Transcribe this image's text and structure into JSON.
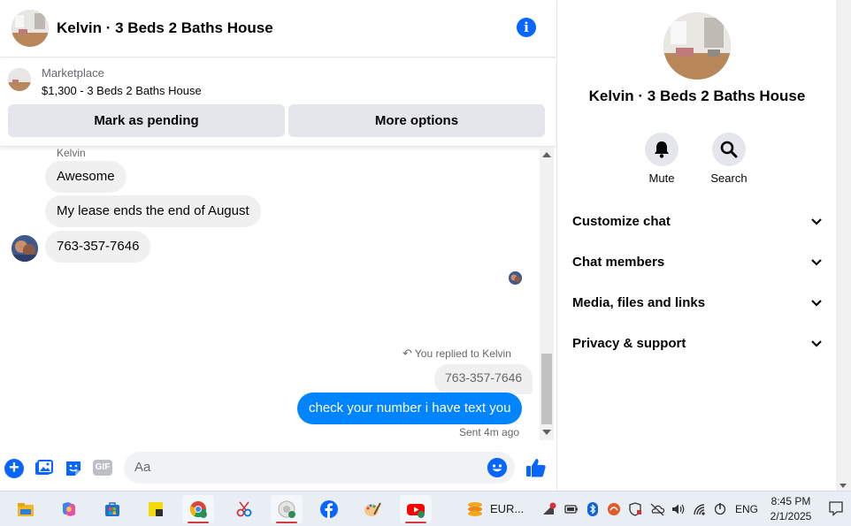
{
  "header": {
    "title": "Kelvin · 3 Beds 2 Baths House"
  },
  "marketplace": {
    "label": "Marketplace",
    "listing": "$1,300 - 3 Beds 2 Baths House",
    "pending_button": "Mark as pending",
    "more_button": "More options"
  },
  "messages": {
    "sender_name": "Kelvin",
    "incoming": [
      "Awesome",
      "My lease ends the end of August",
      "763-357-7646"
    ],
    "replied_label": "You replied to Kelvin",
    "quoted": "763-357-7646",
    "outgoing": "check your number i have text you",
    "sent_status": "Sent 4m ago"
  },
  "composer": {
    "placeholder": "Aa",
    "gif_label": "GIF"
  },
  "side": {
    "title": "Kelvin · 3 Beds 2 Baths House",
    "actions": [
      {
        "label": "Mute",
        "icon": "bell-icon"
      },
      {
        "label": "Search",
        "icon": "search-icon"
      }
    ],
    "sections": [
      "Customize chat",
      "Chat members",
      "Media, files and links",
      "Privacy & support"
    ]
  },
  "taskbar": {
    "eur_label": "EUR...",
    "language": "ENG",
    "time": "8:45 PM",
    "date": "2/1/2025"
  },
  "colors": {
    "accent": "#0866ff",
    "outgoing_bubble": "#0084ff",
    "incoming_bubble": "#f0f0f0",
    "button_bg": "#e4e6eb"
  }
}
